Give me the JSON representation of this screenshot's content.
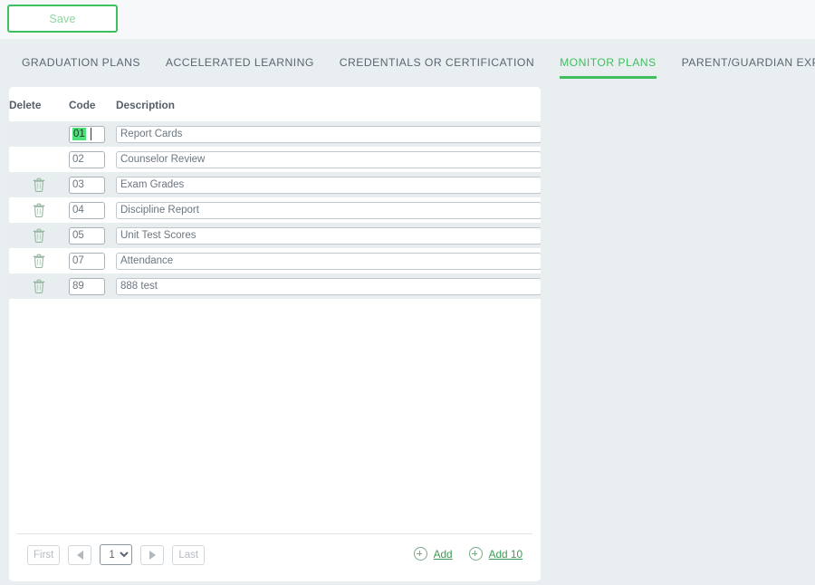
{
  "toolbar": {
    "save_label": "Save"
  },
  "tabs": [
    {
      "label": "GRADUATION PLANS",
      "active": false
    },
    {
      "label": "ACCELERATED LEARNING",
      "active": false
    },
    {
      "label": "CREDENTIALS OR CERTIFICATION",
      "active": false
    },
    {
      "label": "MONITOR PLANS",
      "active": true
    },
    {
      "label": "PARENT/GUARDIAN EXPECTATIONS",
      "active": false
    }
  ],
  "table": {
    "columns": [
      "Delete",
      "Code",
      "Description"
    ],
    "rows": [
      {
        "delete": false,
        "code": "01",
        "description": "Report Cards",
        "selected": true
      },
      {
        "delete": false,
        "code": "02",
        "description": "Counselor Review",
        "selected": false
      },
      {
        "delete": true,
        "code": "03",
        "description": "Exam Grades",
        "selected": false
      },
      {
        "delete": true,
        "code": "04",
        "description": "Discipline Report",
        "selected": false
      },
      {
        "delete": true,
        "code": "05",
        "description": "Unit Test Scores",
        "selected": false
      },
      {
        "delete": true,
        "code": "07",
        "description": "Attendance",
        "selected": false
      },
      {
        "delete": true,
        "code": "89",
        "description": "888 test",
        "selected": false
      }
    ]
  },
  "pagination": {
    "first_label": "First",
    "prev_icon": "arrow-left-icon",
    "page_value": "1",
    "page_options": [
      "1"
    ],
    "next_icon": "arrow-right-icon",
    "last_label": "Last"
  },
  "actions": {
    "add_label": "Add",
    "add_ten_label": "Add 10"
  },
  "colors": {
    "accent_green": "#3fbf5f",
    "tab_strip_bg": "#e9eff1",
    "row_alt_bg": "#e8eef0",
    "selection_green": "#4ce07a",
    "link_green": "#3d9a55"
  }
}
